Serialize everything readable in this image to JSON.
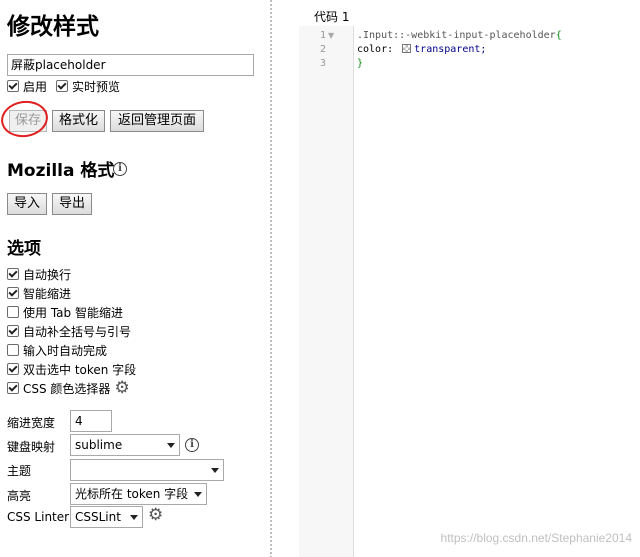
{
  "page": {
    "title": "修改样式",
    "name_value": "屏蔽placeholder",
    "enable_label": "启用",
    "live_preview_label": "实时预览",
    "save_label": "保存",
    "format_label": "格式化",
    "back_label": "返回管理页面"
  },
  "mozilla": {
    "title": "Mozilla 格式",
    "import_label": "导入",
    "export_label": "导出"
  },
  "options": {
    "title": "选项",
    "checkboxes": [
      {
        "label": "自动换行",
        "checked": true
      },
      {
        "label": "智能缩进",
        "checked": true
      },
      {
        "label": "使用 Tab 智能缩进",
        "checked": false
      },
      {
        "label": "自动补全括号与引号",
        "checked": true
      },
      {
        "label": "输入时自动完成",
        "checked": false
      },
      {
        "label": "双击选中 token 字段",
        "checked": true
      },
      {
        "label": "CSS 颜色选择器",
        "checked": true
      }
    ],
    "indent_label": "缩进宽度",
    "indent_value": "4",
    "keymap_label": "键盘映射",
    "keymap_value": "sublime",
    "theme_label": "主题",
    "theme_value": "",
    "highlight_label": "高亮",
    "highlight_value": "光标所在 token 字段",
    "linter_label": "CSS Linter",
    "linter_value": "CSSLint"
  },
  "editor": {
    "tab_label": "代码 1",
    "line_numbers": [
      "1",
      "2",
      "3"
    ],
    "line1_selector": ".Input::-webkit-input-placeholder",
    "line1_brace": "{",
    "line2_prop": "color:",
    "line2_value": "transparent;",
    "line3_brace": "}"
  },
  "watermark": "https://blog.csdn.net/Stephanie2014",
  "colors": {
    "annotation_circle": "#e02020",
    "code_selector_green": "#0a8a0a",
    "code_value_blue": "#00008b"
  }
}
